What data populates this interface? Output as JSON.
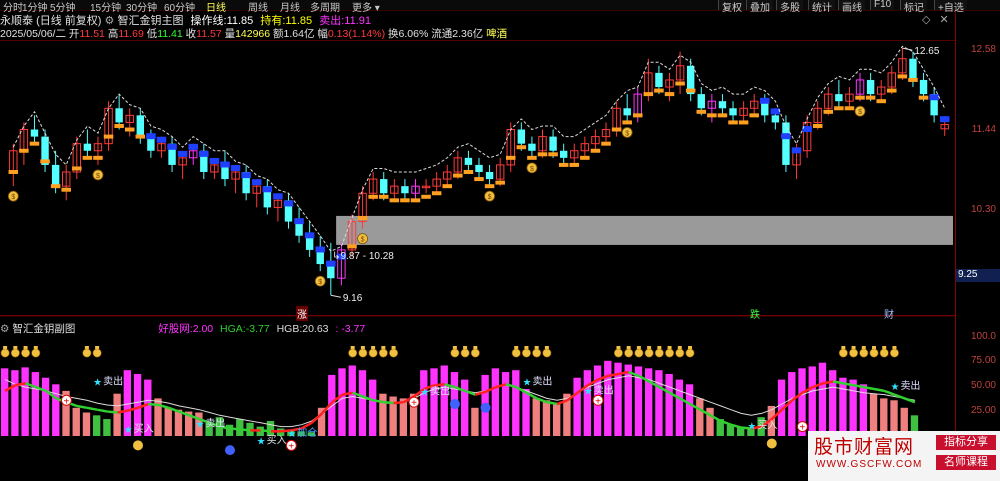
{
  "tabs": [
    {
      "label": "分时"
    },
    {
      "label": "1分钟"
    },
    {
      "label": "5分钟"
    },
    {
      "label": "15分钟"
    },
    {
      "label": "30分钟"
    },
    {
      "label": "60分钟"
    },
    {
      "label": "日线"
    },
    {
      "label": "周线"
    },
    {
      "label": "月线"
    },
    {
      "label": "多周期"
    },
    {
      "label": "更多"
    }
  ],
  "active_tab": "日线",
  "toolbar": [
    "复权",
    "叠加",
    "多股",
    "统计",
    "画线",
    "F10",
    "标记",
    "+自选"
  ],
  "header": {
    "stock_name": "永顺泰",
    "mode": "(日线 前复权)",
    "indicator_name": "智汇金钥主图",
    "op_line_label": "操作线:",
    "op_line_value": "11.85",
    "hold_label": "持有:",
    "hold_value": "11.85",
    "sell_label": "卖出:",
    "sell_value": "11.91"
  },
  "quote": {
    "date": "2025/05/06/二",
    "open_label": "开",
    "open": "11.51",
    "high_label": "高",
    "high": "11.69",
    "low_label": "低",
    "low": "11.41",
    "close_label": "收",
    "close": "11.57",
    "vol_label": "量",
    "vol": "142966",
    "amount_label": "额",
    "amount": "1.64亿",
    "change_label": "幅",
    "change": "0.13(1.14%)",
    "turnover_label": "换",
    "turnover": "6.06%",
    "float_label": "流通",
    "float": "2.36亿",
    "sector": "啤酒"
  },
  "price_axis": [
    "12.58",
    "11.44",
    "10.30",
    "9.25"
  ],
  "price_marks": {
    "high": "12.65",
    "low": "9.16",
    "zone": "9.87 - 10.28"
  },
  "events": [
    {
      "label": "涨"
    },
    {
      "label": "跌"
    },
    {
      "label": "财"
    }
  ],
  "sub_header": {
    "name": "智汇金钥副图",
    "good_label": "好股网:",
    "good_value": "2.00",
    "hga_label": "HGA:",
    "hga_value": "-3.77",
    "hgb_label": "HGB:",
    "hgb_value": "20.63",
    "extra_value": ": -3.77"
  },
  "sub_axis": [
    "100.0",
    "75.00",
    "50.00",
    "25.00"
  ],
  "signals": {
    "sell": "卖出",
    "buy": "买入",
    "add": "加仓"
  },
  "watermark": {
    "title": "股市财富网",
    "url": "WWW.GSCFW.COM",
    "tag1": "指标分享",
    "tag2": "名师课程"
  },
  "colors": {
    "up_candle": "#ff3a3a",
    "down_candle": "#54ffff",
    "magenta": "#ff33ff",
    "orange": "#ffa020",
    "blue": "#2040ff",
    "red_line": "#ff2020",
    "green_line": "#30d030",
    "white_line": "#dcdcdc",
    "pink_bar": "#f08080",
    "green_bar": "#40c040",
    "zone": "#9a9a9a"
  },
  "chart_data": {
    "type": "candlestick",
    "price_range": [
      9.16,
      12.65
    ],
    "candles": [
      [
        10.9,
        11.3,
        10.7,
        11.2
      ],
      [
        11.2,
        11.6,
        11.0,
        11.5
      ],
      [
        11.5,
        11.7,
        11.3,
        11.4
      ],
      [
        11.4,
        11.5,
        10.9,
        11.0
      ],
      [
        11.0,
        11.2,
        10.6,
        10.7
      ],
      [
        10.7,
        11.0,
        10.5,
        10.9
      ],
      [
        10.9,
        11.4,
        10.8,
        11.3
      ],
      [
        11.3,
        11.5,
        11.1,
        11.2
      ],
      [
        11.2,
        11.4,
        11.0,
        11.3
      ],
      [
        11.3,
        11.9,
        11.2,
        11.8
      ],
      [
        11.8,
        12.0,
        11.5,
        11.6
      ],
      [
        11.6,
        11.8,
        11.4,
        11.7
      ],
      [
        11.7,
        11.8,
        11.3,
        11.4
      ],
      [
        11.4,
        11.5,
        11.1,
        11.2
      ],
      [
        11.2,
        11.4,
        11.1,
        11.3
      ],
      [
        11.3,
        11.4,
        10.9,
        11.0
      ],
      [
        11.0,
        11.2,
        10.8,
        11.1
      ],
      [
        11.1,
        11.3,
        11.0,
        11.2
      ],
      [
        11.2,
        11.3,
        10.8,
        10.9
      ],
      [
        10.9,
        11.1,
        10.8,
        11.0
      ],
      [
        11.0,
        11.2,
        10.7,
        10.8
      ],
      [
        10.8,
        11.0,
        10.6,
        10.9
      ],
      [
        10.9,
        11.0,
        10.5,
        10.6
      ],
      [
        10.6,
        10.8,
        10.4,
        10.7
      ],
      [
        10.7,
        10.8,
        10.3,
        10.4
      ],
      [
        10.4,
        10.6,
        10.2,
        10.5
      ],
      [
        10.5,
        10.6,
        10.1,
        10.2
      ],
      [
        10.2,
        10.4,
        9.9,
        10.0
      ],
      [
        10.0,
        10.2,
        9.7,
        9.8
      ],
      [
        9.8,
        10.0,
        9.5,
        9.6
      ],
      [
        9.6,
        9.9,
        9.16,
        9.4
      ],
      [
        9.4,
        9.9,
        9.3,
        9.8
      ],
      [
        9.8,
        10.3,
        9.7,
        10.2
      ],
      [
        10.2,
        10.7,
        10.1,
        10.6
      ],
      [
        10.6,
        10.9,
        10.5,
        10.8
      ],
      [
        10.8,
        10.9,
        10.5,
        10.6
      ],
      [
        10.6,
        10.8,
        10.5,
        10.7
      ],
      [
        10.7,
        10.8,
        10.5,
        10.6
      ],
      [
        10.6,
        10.8,
        10.5,
        10.7
      ],
      [
        10.7,
        10.8,
        10.6,
        10.7
      ],
      [
        10.7,
        10.9,
        10.6,
        10.8
      ],
      [
        10.8,
        11.0,
        10.7,
        10.9
      ],
      [
        10.9,
        11.2,
        10.8,
        11.1
      ],
      [
        11.1,
        11.2,
        10.9,
        11.0
      ],
      [
        11.0,
        11.1,
        10.8,
        10.9
      ],
      [
        10.9,
        11.0,
        10.7,
        10.8
      ],
      [
        10.8,
        11.1,
        10.7,
        11.0
      ],
      [
        11.0,
        11.6,
        10.9,
        11.5
      ],
      [
        11.5,
        11.6,
        11.2,
        11.3
      ],
      [
        11.3,
        11.4,
        11.1,
        11.2
      ],
      [
        11.2,
        11.5,
        11.1,
        11.4
      ],
      [
        11.4,
        11.5,
        11.1,
        11.2
      ],
      [
        11.2,
        11.3,
        11.0,
        11.1
      ],
      [
        11.1,
        11.3,
        11.0,
        11.2
      ],
      [
        11.2,
        11.4,
        11.1,
        11.3
      ],
      [
        11.3,
        11.5,
        11.2,
        11.4
      ],
      [
        11.4,
        11.6,
        11.3,
        11.5
      ],
      [
        11.5,
        11.9,
        11.4,
        11.8
      ],
      [
        11.8,
        12.0,
        11.6,
        11.7
      ],
      [
        11.7,
        12.1,
        11.6,
        12.0
      ],
      [
        12.0,
        12.5,
        11.9,
        12.3
      ],
      [
        12.3,
        12.4,
        12.0,
        12.1
      ],
      [
        12.1,
        12.3,
        11.9,
        12.2
      ],
      [
        12.2,
        12.6,
        12.0,
        12.4
      ],
      [
        12.4,
        12.5,
        11.9,
        12.0
      ],
      [
        12.0,
        12.1,
        11.7,
        11.8
      ],
      [
        11.8,
        12.0,
        11.6,
        11.9
      ],
      [
        11.9,
        12.0,
        11.7,
        11.8
      ],
      [
        11.8,
        11.9,
        11.6,
        11.7
      ],
      [
        11.7,
        11.9,
        11.6,
        11.8
      ],
      [
        11.8,
        12.0,
        11.7,
        11.9
      ],
      [
        11.9,
        12.0,
        11.6,
        11.7
      ],
      [
        11.7,
        11.8,
        11.5,
        11.6
      ],
      [
        11.6,
        11.7,
        10.9,
        11.0
      ],
      [
        11.0,
        11.3,
        10.8,
        11.2
      ],
      [
        11.2,
        11.7,
        11.1,
        11.6
      ],
      [
        11.6,
        11.9,
        11.5,
        11.8
      ],
      [
        11.8,
        12.1,
        11.7,
        12.0
      ],
      [
        12.0,
        12.2,
        11.8,
        11.9
      ],
      [
        11.9,
        12.1,
        11.8,
        12.0
      ],
      [
        12.0,
        12.3,
        11.9,
        12.2
      ],
      [
        12.2,
        12.3,
        11.9,
        12.0
      ],
      [
        12.0,
        12.2,
        11.9,
        12.1
      ],
      [
        12.1,
        12.4,
        12.0,
        12.3
      ],
      [
        12.3,
        12.65,
        12.2,
        12.5
      ],
      [
        12.5,
        12.6,
        12.1,
        12.2
      ],
      [
        12.2,
        12.3,
        11.9,
        12.0
      ],
      [
        12.0,
        12.1,
        11.6,
        11.7
      ],
      [
        11.51,
        11.69,
        11.41,
        11.57
      ]
    ],
    "subchart": {
      "range": [
        0,
        100
      ],
      "bars": [
        72,
        70,
        73,
        68,
        62,
        55,
        48,
        30,
        25,
        22,
        18,
        45,
        70,
        66,
        60,
        40,
        30,
        28,
        26,
        25,
        15,
        20,
        12,
        18,
        14,
        10,
        16,
        8,
        6,
        5,
        4,
        30,
        65,
        72,
        75,
        70,
        60,
        45,
        42,
        40,
        45,
        70,
        72,
        75,
        68,
        60,
        30,
        65,
        72,
        68,
        70,
        50,
        40,
        38,
        35,
        45,
        62,
        70,
        75,
        80,
        78,
        76,
        74,
        72,
        70,
        66,
        60,
        55,
        40,
        30,
        18,
        12,
        10,
        8,
        20,
        32,
        60,
        68,
        72,
        74,
        78,
        70,
        62,
        60,
        55,
        45,
        40,
        38,
        30,
        22
      ],
      "line_white": [
        60,
        55,
        52,
        50,
        48,
        45,
        42,
        40,
        38,
        35,
        33,
        32,
        34,
        36,
        38,
        37,
        35,
        32,
        30,
        28,
        25,
        22,
        20,
        18,
        16,
        14,
        12,
        10,
        10,
        12,
        16,
        24,
        32,
        40,
        42,
        40,
        38,
        36,
        35,
        36,
        40,
        46,
        50,
        52,
        50,
        48,
        46,
        48,
        52,
        54,
        52,
        48,
        44,
        40,
        38,
        40,
        46,
        52,
        56,
        60,
        62,
        64,
        62,
        60,
        56,
        52,
        48,
        44,
        40,
        36,
        32,
        28,
        24,
        22,
        24,
        28,
        34,
        40,
        44,
        48,
        50,
        52,
        50,
        48,
        46,
        45,
        44,
        42,
        40,
        38
      ],
      "line_main": [
        48,
        54,
        56,
        52,
        48,
        40,
        36,
        32,
        30,
        28,
        26,
        25,
        27,
        30,
        34,
        33,
        30,
        26,
        22,
        18,
        14,
        10,
        8,
        7,
        6,
        6,
        5,
        5,
        6,
        8,
        14,
        24,
        36,
        44,
        46,
        42,
        38,
        36,
        35,
        36,
        42,
        50,
        54,
        55,
        52,
        48,
        44,
        47,
        52,
        55,
        52,
        46,
        40,
        36,
        34,
        38,
        46,
        54,
        60,
        64,
        66,
        68,
        64,
        58,
        52,
        46,
        40,
        34,
        28,
        22,
        16,
        12,
        9,
        8,
        10,
        18,
        28,
        38,
        46,
        52,
        56,
        58,
        56,
        54,
        52,
        50,
        48,
        44,
        40,
        36
      ]
    }
  }
}
